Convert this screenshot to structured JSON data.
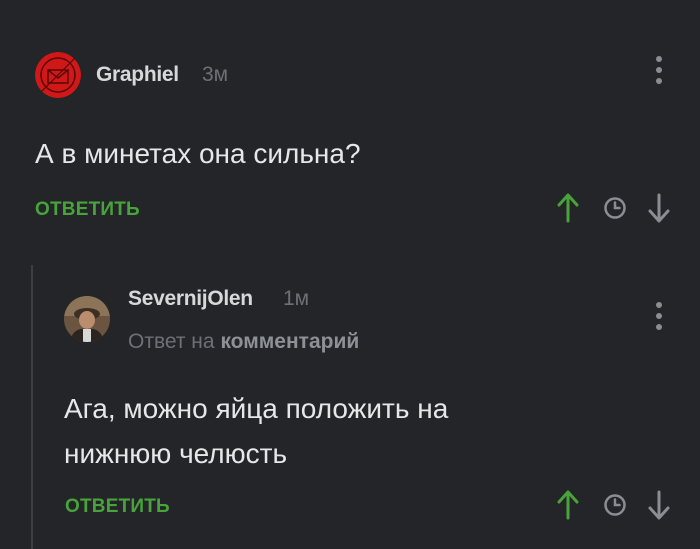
{
  "comments": [
    {
      "author": "Graphiel",
      "time": "3м",
      "text": "А в минетах она сильна?",
      "reply_label": "ОТВЕТИТЬ"
    },
    {
      "author": "SevernijOlen",
      "time": "1м",
      "reply_prefix": "Ответ на",
      "reply_target": "комментарий",
      "text_line1": "Ага, можно яйца положить на",
      "text_line2": "нижнюю челюсть",
      "reply_label": "ОТВЕТИТЬ"
    }
  ],
  "icons": {
    "upvote": "arrow-up-icon",
    "later": "clock-icon",
    "downvote": "arrow-down-icon",
    "menu": "more-vertical-icon"
  },
  "colors": {
    "background": "#232528",
    "accent_green": "#48a33b",
    "avatar_red": "#d01818"
  }
}
